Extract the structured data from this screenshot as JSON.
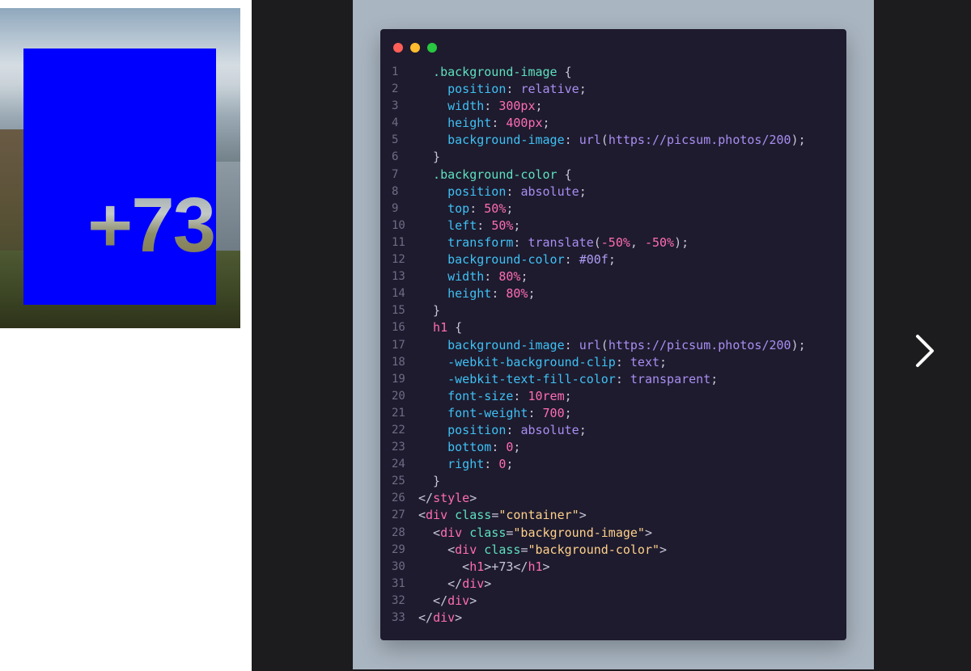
{
  "preview": {
    "counter_text": "+73",
    "image_colors": {
      "overlay": "#0000ff"
    }
  },
  "slide": {
    "window_controls": [
      "red-dot",
      "yellow-dot",
      "green-dot"
    ],
    "next_icon": "chevron-right-icon",
    "code_lines": [
      [
        [
          "sel",
          "  .background-image "
        ],
        [
          "p",
          "{"
        ]
      ],
      [
        [
          "prop",
          "    position"
        ],
        [
          "p",
          ": "
        ],
        [
          "val",
          "relative"
        ],
        [
          "p",
          ";"
        ]
      ],
      [
        [
          "prop",
          "    width"
        ],
        [
          "p",
          ": "
        ],
        [
          "num",
          "300px"
        ],
        [
          "p",
          ";"
        ]
      ],
      [
        [
          "prop",
          "    height"
        ],
        [
          "p",
          ": "
        ],
        [
          "num",
          "400px"
        ],
        [
          "p",
          ";"
        ]
      ],
      [
        [
          "prop",
          "    background-image"
        ],
        [
          "p",
          ": "
        ],
        [
          "val",
          "url"
        ],
        [
          "p",
          "("
        ],
        [
          "val",
          "https://picsum.photos/200"
        ],
        [
          "p",
          ");"
        ]
      ],
      [
        [
          "p",
          "  }"
        ]
      ],
      [
        [
          "sel",
          "  .background-color "
        ],
        [
          "p",
          "{"
        ]
      ],
      [
        [
          "prop",
          "    position"
        ],
        [
          "p",
          ": "
        ],
        [
          "val",
          "absolute"
        ],
        [
          "p",
          ";"
        ]
      ],
      [
        [
          "prop",
          "    top"
        ],
        [
          "p",
          ": "
        ],
        [
          "num",
          "50%"
        ],
        [
          "p",
          ";"
        ]
      ],
      [
        [
          "prop",
          "    left"
        ],
        [
          "p",
          ": "
        ],
        [
          "num",
          "50%"
        ],
        [
          "p",
          ";"
        ]
      ],
      [
        [
          "prop",
          "    transform"
        ],
        [
          "p",
          ": "
        ],
        [
          "val",
          "translate"
        ],
        [
          "p",
          "("
        ],
        [
          "num",
          "-50%"
        ],
        [
          "p",
          ", "
        ],
        [
          "num",
          "-50%"
        ],
        [
          "p",
          ");"
        ]
      ],
      [
        [
          "prop",
          "    background-color"
        ],
        [
          "p",
          ": "
        ],
        [
          "hex",
          "#00f"
        ],
        [
          "p",
          ";"
        ]
      ],
      [
        [
          "prop",
          "    width"
        ],
        [
          "p",
          ": "
        ],
        [
          "num",
          "80%"
        ],
        [
          "p",
          ";"
        ]
      ],
      [
        [
          "prop",
          "    height"
        ],
        [
          "p",
          ": "
        ],
        [
          "num",
          "80%"
        ],
        [
          "p",
          ";"
        ]
      ],
      [
        [
          "p",
          "  }"
        ]
      ],
      [
        [
          "tag",
          "  h1 "
        ],
        [
          "p",
          "{"
        ]
      ],
      [
        [
          "prop",
          "    background-image"
        ],
        [
          "p",
          ": "
        ],
        [
          "val",
          "url"
        ],
        [
          "p",
          "("
        ],
        [
          "val",
          "https://picsum.photos/200"
        ],
        [
          "p",
          ");"
        ]
      ],
      [
        [
          "prop",
          "    -webkit-background-clip"
        ],
        [
          "p",
          ": "
        ],
        [
          "val",
          "text"
        ],
        [
          "p",
          ";"
        ]
      ],
      [
        [
          "prop",
          "    -webkit-text-fill-color"
        ],
        [
          "p",
          ": "
        ],
        [
          "val",
          "transparent"
        ],
        [
          "p",
          ";"
        ]
      ],
      [
        [
          "prop",
          "    font-size"
        ],
        [
          "p",
          ": "
        ],
        [
          "num",
          "10rem"
        ],
        [
          "p",
          ";"
        ]
      ],
      [
        [
          "prop",
          "    font-weight"
        ],
        [
          "p",
          ": "
        ],
        [
          "num",
          "700"
        ],
        [
          "p",
          ";"
        ]
      ],
      [
        [
          "prop",
          "    position"
        ],
        [
          "p",
          ": "
        ],
        [
          "val",
          "absolute"
        ],
        [
          "p",
          ";"
        ]
      ],
      [
        [
          "prop",
          "    bottom"
        ],
        [
          "p",
          ": "
        ],
        [
          "num",
          "0"
        ],
        [
          "p",
          ";"
        ]
      ],
      [
        [
          "prop",
          "    right"
        ],
        [
          "p",
          ": "
        ],
        [
          "num",
          "0"
        ],
        [
          "p",
          ";"
        ]
      ],
      [
        [
          "p",
          "  }"
        ]
      ],
      [
        [
          "p",
          "</"
        ],
        [
          "tag",
          "style"
        ],
        [
          "p",
          ">"
        ]
      ],
      [
        [
          "p",
          "<"
        ],
        [
          "tag",
          "div"
        ],
        [
          "p",
          " "
        ],
        [
          "attr",
          "class"
        ],
        [
          "p",
          "="
        ],
        [
          "str",
          "\"container\""
        ],
        [
          "p",
          ">"
        ]
      ],
      [
        [
          "p",
          "  <"
        ],
        [
          "tag",
          "div"
        ],
        [
          "p",
          " "
        ],
        [
          "attr",
          "class"
        ],
        [
          "p",
          "="
        ],
        [
          "str",
          "\"background-image\""
        ],
        [
          "p",
          ">"
        ]
      ],
      [
        [
          "p",
          "    <"
        ],
        [
          "tag",
          "div"
        ],
        [
          "p",
          " "
        ],
        [
          "attr",
          "class"
        ],
        [
          "p",
          "="
        ],
        [
          "str",
          "\"background-color\""
        ],
        [
          "p",
          ">"
        ]
      ],
      [
        [
          "p",
          "      <"
        ],
        [
          "tag",
          "h1"
        ],
        [
          "p",
          ">+73</"
        ],
        [
          "tag",
          "h1"
        ],
        [
          "p",
          ">"
        ]
      ],
      [
        [
          "p",
          "    </"
        ],
        [
          "tag",
          "div"
        ],
        [
          "p",
          ">"
        ]
      ],
      [
        [
          "p",
          "  </"
        ],
        [
          "tag",
          "div"
        ],
        [
          "p",
          ">"
        ]
      ],
      [
        [
          "p",
          "</"
        ],
        [
          "tag",
          "div"
        ],
        [
          "p",
          ">"
        ]
      ]
    ]
  }
}
